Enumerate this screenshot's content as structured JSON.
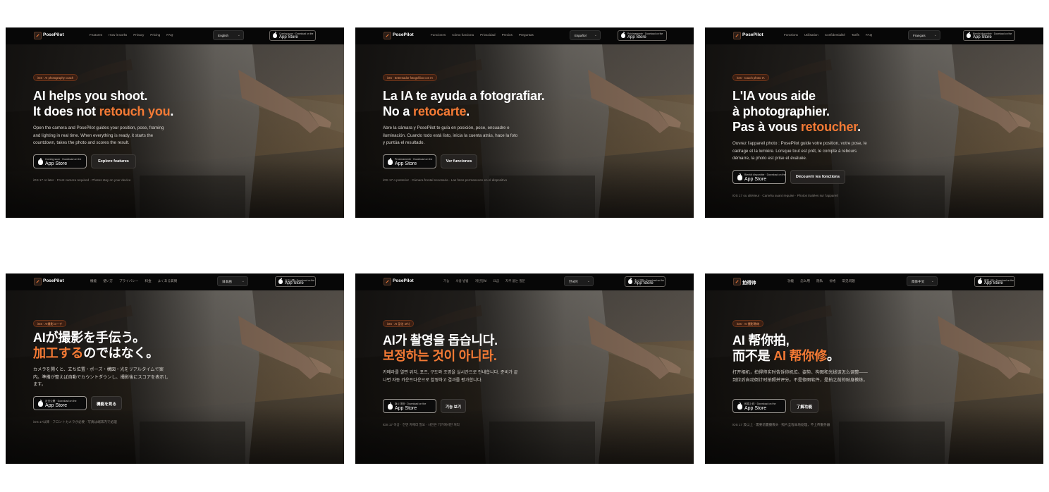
{
  "panels": [
    {
      "lang_key": "en",
      "brand": "PosePilot",
      "nav": [
        "Features",
        "How it works",
        "Privacy",
        "Pricing",
        "FAQ"
      ],
      "language": "English",
      "store_small": "Coming soon · Download on the",
      "store_big": "App Store",
      "badge": "iOS · AI photography coach",
      "headline_lines": [
        {
          "plain": "AI helps you shoot.",
          "accent": "",
          "tail": ""
        },
        {
          "plain": "It does not ",
          "accent": "retouch you",
          "tail": "."
        }
      ],
      "description": "Open the camera and PosePilot guides your position, pose, framing and lighting in real time. When everything is ready, it starts the countdown, takes the photo and scores the result.",
      "hero_store_small": "Coming soon · Download on the",
      "hero_store_big": "App Store",
      "secondary_button": "Explore features",
      "footnote": "iOS 17 or later · Front camera required · Photos stay on your device"
    },
    {
      "lang_key": "es",
      "brand": "PosePilot",
      "nav": [
        "Funciones",
        "Cómo funciona",
        "Privacidad",
        "Precios",
        "Preguntas"
      ],
      "language": "Español",
      "store_small": "Próximamente · Download on the",
      "store_big": "App Store",
      "badge": "iOS · Entrenador fotográfico con IA",
      "headline_lines": [
        {
          "plain": "La IA te ayuda a fotografiar.",
          "accent": "",
          "tail": ""
        },
        {
          "plain": "No a ",
          "accent": "retocarte",
          "tail": "."
        }
      ],
      "description": "Abre la cámara y PosePilot te guía en posición, pose, encuadre e iluminación. Cuando todo está listo, inicia la cuenta atrás, hace la foto y puntúa el resultado.",
      "hero_store_small": "Próximamente · Download on the",
      "hero_store_big": "App Store",
      "secondary_button": "Ver funciones",
      "footnote": "iOS 17 o posterior · Cámara frontal necesaria · Las fotos permanecen en el dispositivo"
    },
    {
      "lang_key": "fr",
      "brand": "PosePilot",
      "nav": [
        "Fonctions",
        "Utilisation",
        "Confidentialité",
        "Tarifs",
        "FAQ"
      ],
      "language": "Français",
      "store_small": "Bientôt disponible · Download on the",
      "store_big": "App Store",
      "badge": "iOS · Coach photo IA",
      "headline_lines": [
        {
          "plain": "L'IA vous aide",
          "accent": "",
          "tail": ""
        },
        {
          "plain": "à photographier.",
          "accent": "",
          "tail": ""
        },
        {
          "plain": "Pas à vous ",
          "accent": "retoucher",
          "tail": "."
        }
      ],
      "description": "Ouvrez l'appareil photo : PosePilot guide votre position, votre pose, le cadrage et la lumière. Lorsque tout est prêt, le compte à rebours démarre, la photo est prise et évaluée.",
      "hero_store_small": "Bientôt disponible · Download on the",
      "hero_store_big": "App Store",
      "secondary_button": "Découvrir les fonctions",
      "footnote": "iOS 17 ou ultérieur · Caméra avant requise · Photos traitées sur l'appareil"
    },
    {
      "lang_key": "ja",
      "brand": "PosePilot",
      "nav": [
        "機能",
        "使い方",
        "プライバシー",
        "料金",
        "よくある質問"
      ],
      "language": "日本語",
      "store_small": "近日公開 · Download on the",
      "store_big": "App Store",
      "badge": "iOS · AI撮影コーチ",
      "headline_lines": [
        {
          "plain": "AIが撮影を手伝う。",
          "accent": "",
          "tail": ""
        },
        {
          "plain": "",
          "accent": "加工する",
          "tail": "のではなく。"
        }
      ],
      "description": "カメラを開くと、立ち位置・ポーズ・構図・光をリアルタイムで案内。準備が整えば自動でカウントダウンし、撮影後にスコアを表示します。",
      "hero_store_small": "近日公開 · Download on the",
      "hero_store_big": "App Store",
      "secondary_button": "機能を見る",
      "footnote": "iOS 17以降 · フロントカメラが必要 · 写真は端末内で処理"
    },
    {
      "lang_key": "ko",
      "brand": "PosePilot",
      "nav": [
        "기능",
        "사용 방법",
        "개인정보",
        "요금",
        "자주 묻는 질문"
      ],
      "language": "한국어",
      "store_small": "출시 예정 · Download on the",
      "store_big": "App Store",
      "badge": "iOS · AI 촬영 코치",
      "headline_lines": [
        {
          "plain": "AI가 촬영을 돕습니다.",
          "accent": "",
          "tail": ""
        },
        {
          "plain": "",
          "accent": "보정하는 것이 아니라.",
          "tail": ""
        }
      ],
      "description": "카메라를 열면 위치, 포즈, 구도와 조명을 실시간으로 안내합니다. 준비가 끝나면 자동 카운트다운으로 촬영하고 결과를 평가합니다.",
      "hero_store_small": "출시 예정 · Download on the",
      "hero_store_big": "App Store",
      "secondary_button": "기능 보기",
      "footnote": "iOS 17 이상 · 전면 카메라 필요 · 사진은 기기에서만 처리"
    },
    {
      "lang_key": "zh",
      "brand": "拍得帅",
      "nav": [
        "功能",
        "怎么用",
        "隐私",
        "价格",
        "常见问题"
      ],
      "language": "简体中文",
      "store_small": "即将上线 · Download on the",
      "store_big": "App Store",
      "badge": "iOS · AI 摄影教练",
      "headline_lines": [
        {
          "plain": "AI 帮你拍,",
          "accent": "",
          "tail": ""
        },
        {
          "plain": "而不是 ",
          "accent": "AI 帮你修",
          "tail": "。"
        }
      ],
      "description": "打开相机，拍得帅实时告诉你机位、姿势、构图和光线该怎么调整—— 到位后自动倒计时拍照并评分。不是修图软件，是拍之前的贴身教练。",
      "hero_store_small": "即将上线 · Download on the",
      "hero_store_big": "App Store",
      "secondary_button": "了解功能",
      "footnote": "iOS 17 及以上 · 需要前置摄像头 · 照片全程本地处理，不上传服务器"
    }
  ],
  "colors": {
    "accent": "#f47a35",
    "badge_text": "#f19b66",
    "badge_bg": "#3a1e12",
    "topbar": "#070707"
  },
  "icons": {
    "logo": "posepilot-logo-icon",
    "apple": "apple-logo-icon",
    "dropdown": "chevron-down-icon"
  }
}
